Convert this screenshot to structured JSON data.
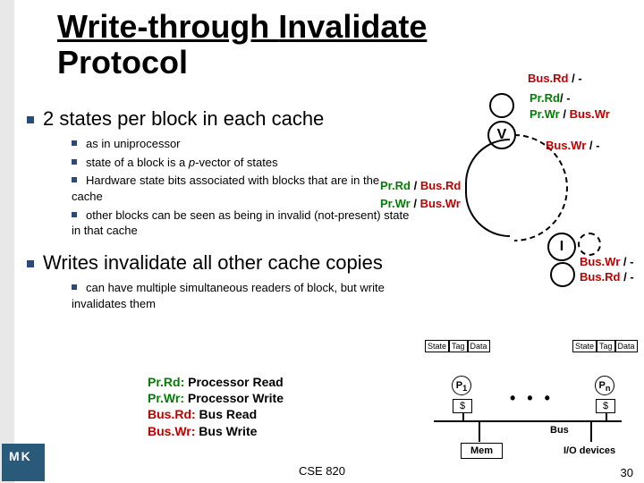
{
  "title_part1": "Write-through ",
  "title_part2": "Invalidate",
  "title_line2": "Protocol",
  "main1": "2 states per block in each cache",
  "sub": [
    "as in uniprocessor",
    "state of a block is a p-vector of states",
    "Hardware state bits associated with blocks that are in the cache",
    "other blocks can be seen as being in invalid (not-present) state in that cache"
  ],
  "main2": "Writes invalidate all other cache copies",
  "sub2": [
    "can have multiple simultaneous readers of block, but write invalidates them"
  ],
  "legend": {
    "l1a": "Pr.Rd:",
    "l1b": " Processor Read",
    "l2a": "Pr.Wr:",
    "l2b": " Processor Write",
    "l3a": "Bus.Rd:",
    "l3b": " Bus Read",
    "l4a": "Bus.Wr:",
    "l4b": " Bus Write"
  },
  "diagram": {
    "v": "V",
    "i": "I",
    "top_busrd": "Bus.Rd",
    "top_slash": " / -",
    "v_prrd": "Pr.Rd",
    "v_prrd2": "/ -",
    "v_prwr": "Pr.Wr",
    "v_buswr": "Bus.Wr",
    "v_right": "Bus.Wr",
    "v_right2": " / -",
    "mid_prrd": "Pr.Rd",
    "mid_busrd": "Bus.Rd",
    "mid_prwr": "Pr.Wr",
    "mid_buswr": "Bus.Wr",
    "i_buswr": "Bus.Wr",
    "i_slash": " / -",
    "i_busrd": "Bus.Rd",
    "i_slash2": " / -"
  },
  "arch": {
    "hdr_state": "State",
    "hdr_tag": "Tag",
    "hdr_data": "Data",
    "p1": "P",
    "p1sub": "1",
    "pn": "P",
    "pnsub": "n",
    "cache": "$",
    "bus": "Bus",
    "mem": "Mem",
    "io": "I/O devices"
  },
  "footer": {
    "center": "CSE 820",
    "num": "30"
  }
}
